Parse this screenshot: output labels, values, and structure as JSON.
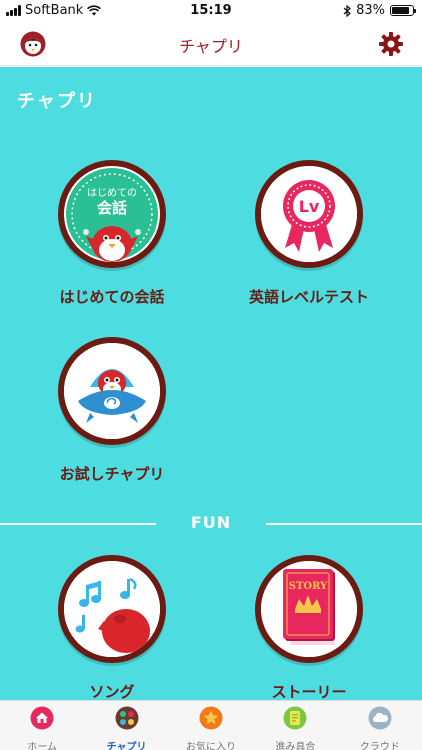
{
  "status_bar": {
    "carrier": "SoftBank",
    "time": "15:19",
    "battery": "83%",
    "battery_level": 0.83
  },
  "nav": {
    "title": "チャプリ"
  },
  "main": {
    "section_title": "チャプリ",
    "apps": [
      {
        "label": "はじめての会話",
        "badge_line1": "はじめての",
        "badge_line2": "会話"
      },
      {
        "label": "英語レベルテスト",
        "badge_text": "Lv"
      },
      {
        "label": "お試しチャプリ"
      }
    ],
    "fun_section": "FUN",
    "fun_apps": [
      {
        "label": "ソング"
      },
      {
        "label": "ストーリー",
        "badge_text": "STORY"
      }
    ]
  },
  "tab_bar": {
    "tabs": [
      {
        "label": "ホーム",
        "icon": "home-icon",
        "active": false
      },
      {
        "label": "チャプリ",
        "icon": "chapuri-icon",
        "active": true
      },
      {
        "label": "お気に入り",
        "icon": "star-icon",
        "active": false
      },
      {
        "label": "進み具合",
        "icon": "progress-icon",
        "active": false
      },
      {
        "label": "クラウド",
        "icon": "cloud-icon",
        "active": false
      }
    ]
  },
  "colors": {
    "accent": "#a01e28",
    "background": "#4ddde0",
    "tile_ring": "#6b1b12",
    "active_tab": "#1f67c6"
  }
}
